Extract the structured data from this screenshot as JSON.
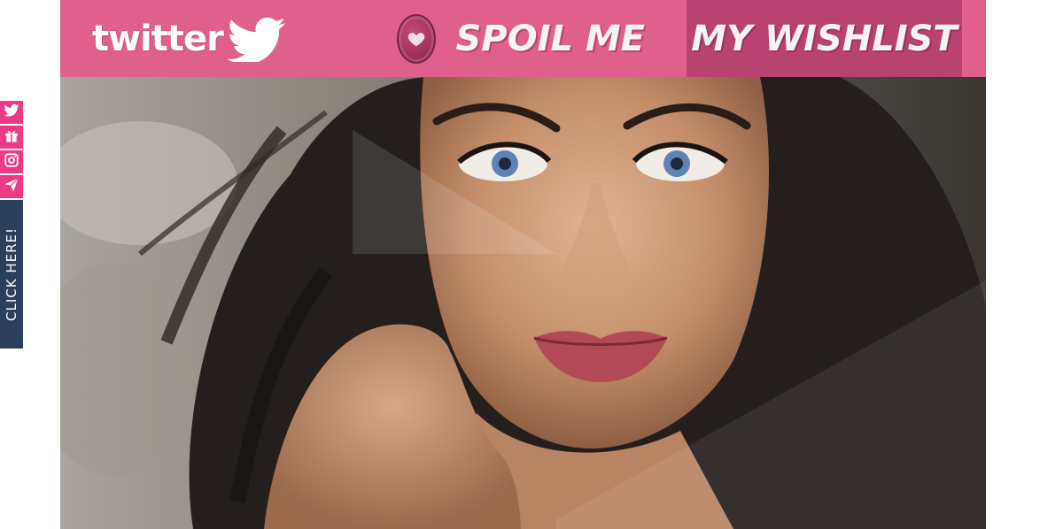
{
  "nav": {
    "twitter_label": "twitter",
    "spoil_label": "SPOIL ME",
    "wishlist_label": "MY WISHLIST"
  },
  "sidebar": {
    "icons": [
      "twitter-icon",
      "gift-icon",
      "instagram-icon",
      "send-icon"
    ],
    "click_tab_label": "CLICK HERE!"
  },
  "colors": {
    "nav_bg": "#e0608d",
    "nav_active_bg": "#b84371",
    "sidebar_icon_bg": "#ec3a86",
    "click_tab_bg": "#2a3f5c"
  }
}
